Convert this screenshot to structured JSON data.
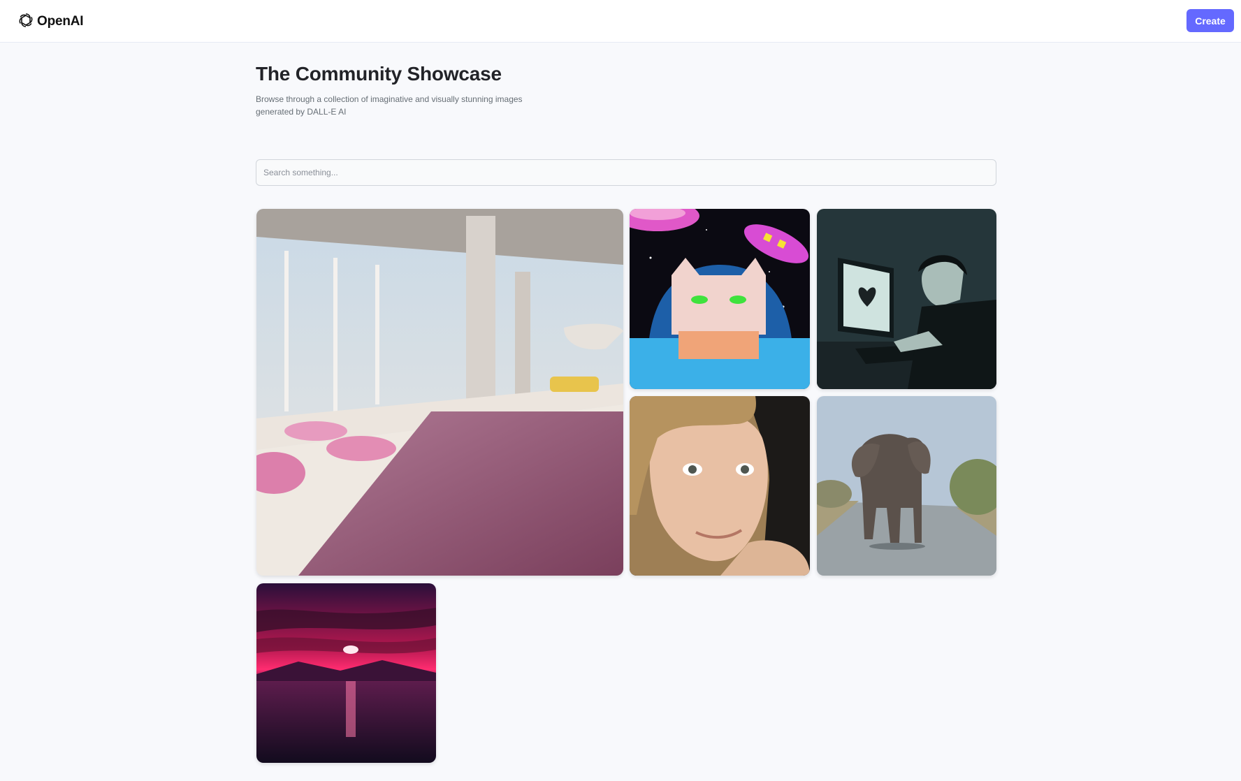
{
  "header": {
    "logo_text": "OpenAI",
    "create_label": "Create"
  },
  "main": {
    "title": "The Community Showcase",
    "subtitle": "Browse through a collection of imaginative and visually stunning images generated by DALL-E AI"
  },
  "search": {
    "placeholder": "Search something..."
  },
  "gallery": {
    "images": [
      {
        "subject": "pink poolside interior"
      },
      {
        "subject": "crayon cat astronaut in space"
      },
      {
        "subject": "person at computer with heart"
      },
      {
        "subject": "portrait of young woman"
      },
      {
        "subject": "elephant walking on road"
      },
      {
        "subject": "magenta sunset over sea"
      }
    ]
  },
  "colors": {
    "accent": "#6469ff",
    "background": "#f8f9fc",
    "title": "#222328",
    "subtitle": "#666e75"
  }
}
